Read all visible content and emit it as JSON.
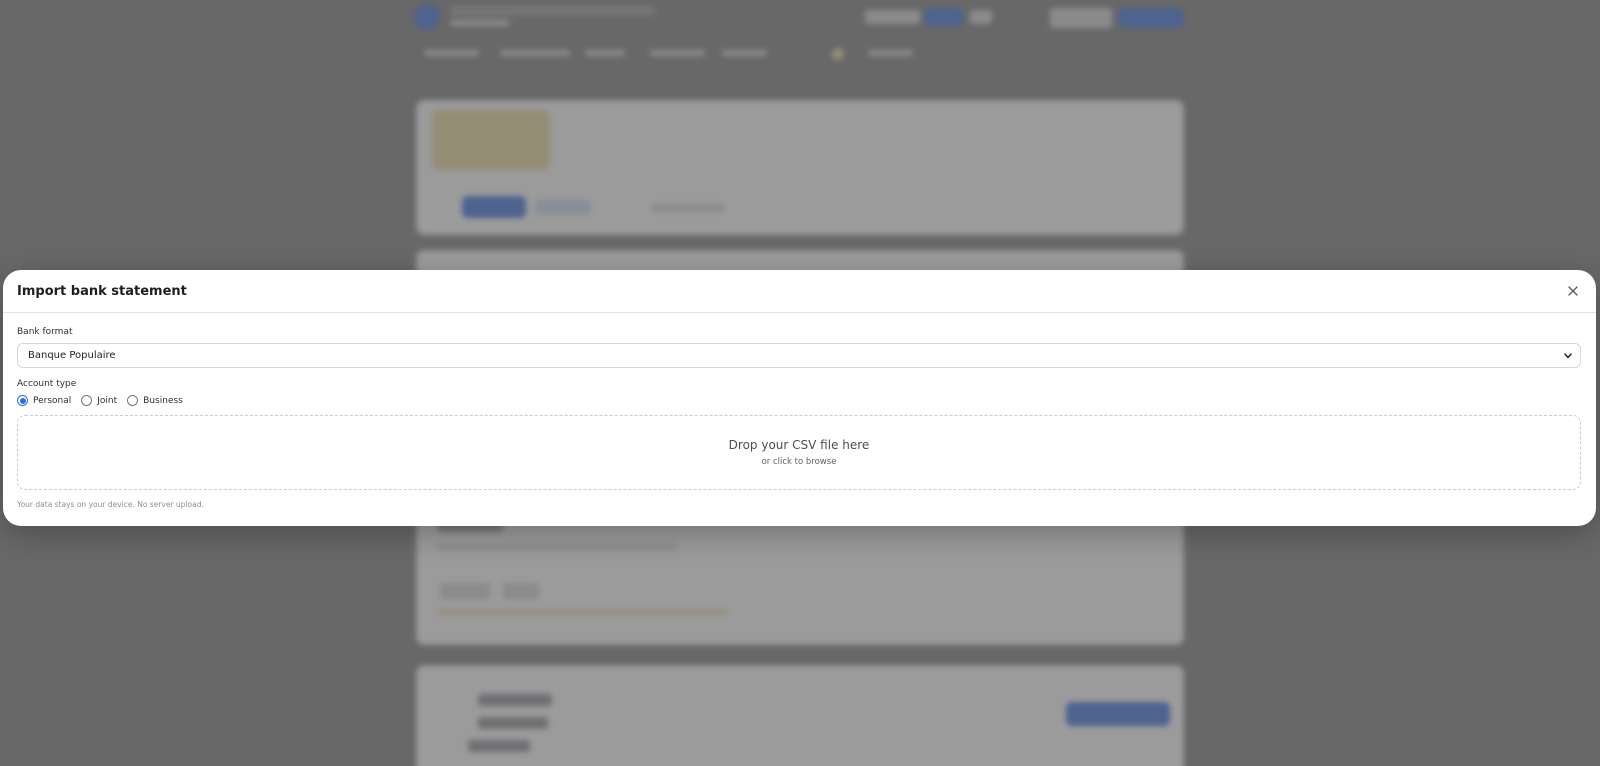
{
  "modal": {
    "title": "Import bank statement",
    "close_icon": "close-icon",
    "bank_format": {
      "label": "Bank format",
      "selected": "Banque Populaire"
    },
    "account_type": {
      "label": "Account type",
      "options": [
        {
          "label": "Personal",
          "checked": true
        },
        {
          "label": "Joint",
          "checked": false
        },
        {
          "label": "Business",
          "checked": false
        }
      ]
    },
    "dropzone": {
      "title": "Drop your CSV file here",
      "subtitle": "or click to browse"
    },
    "footnote": "Your data stays on your device. No server upload."
  },
  "colors": {
    "accent": "#2f6fdc",
    "dropzone_border": "#b9d1e6",
    "overlay": "#7a7a7a"
  }
}
